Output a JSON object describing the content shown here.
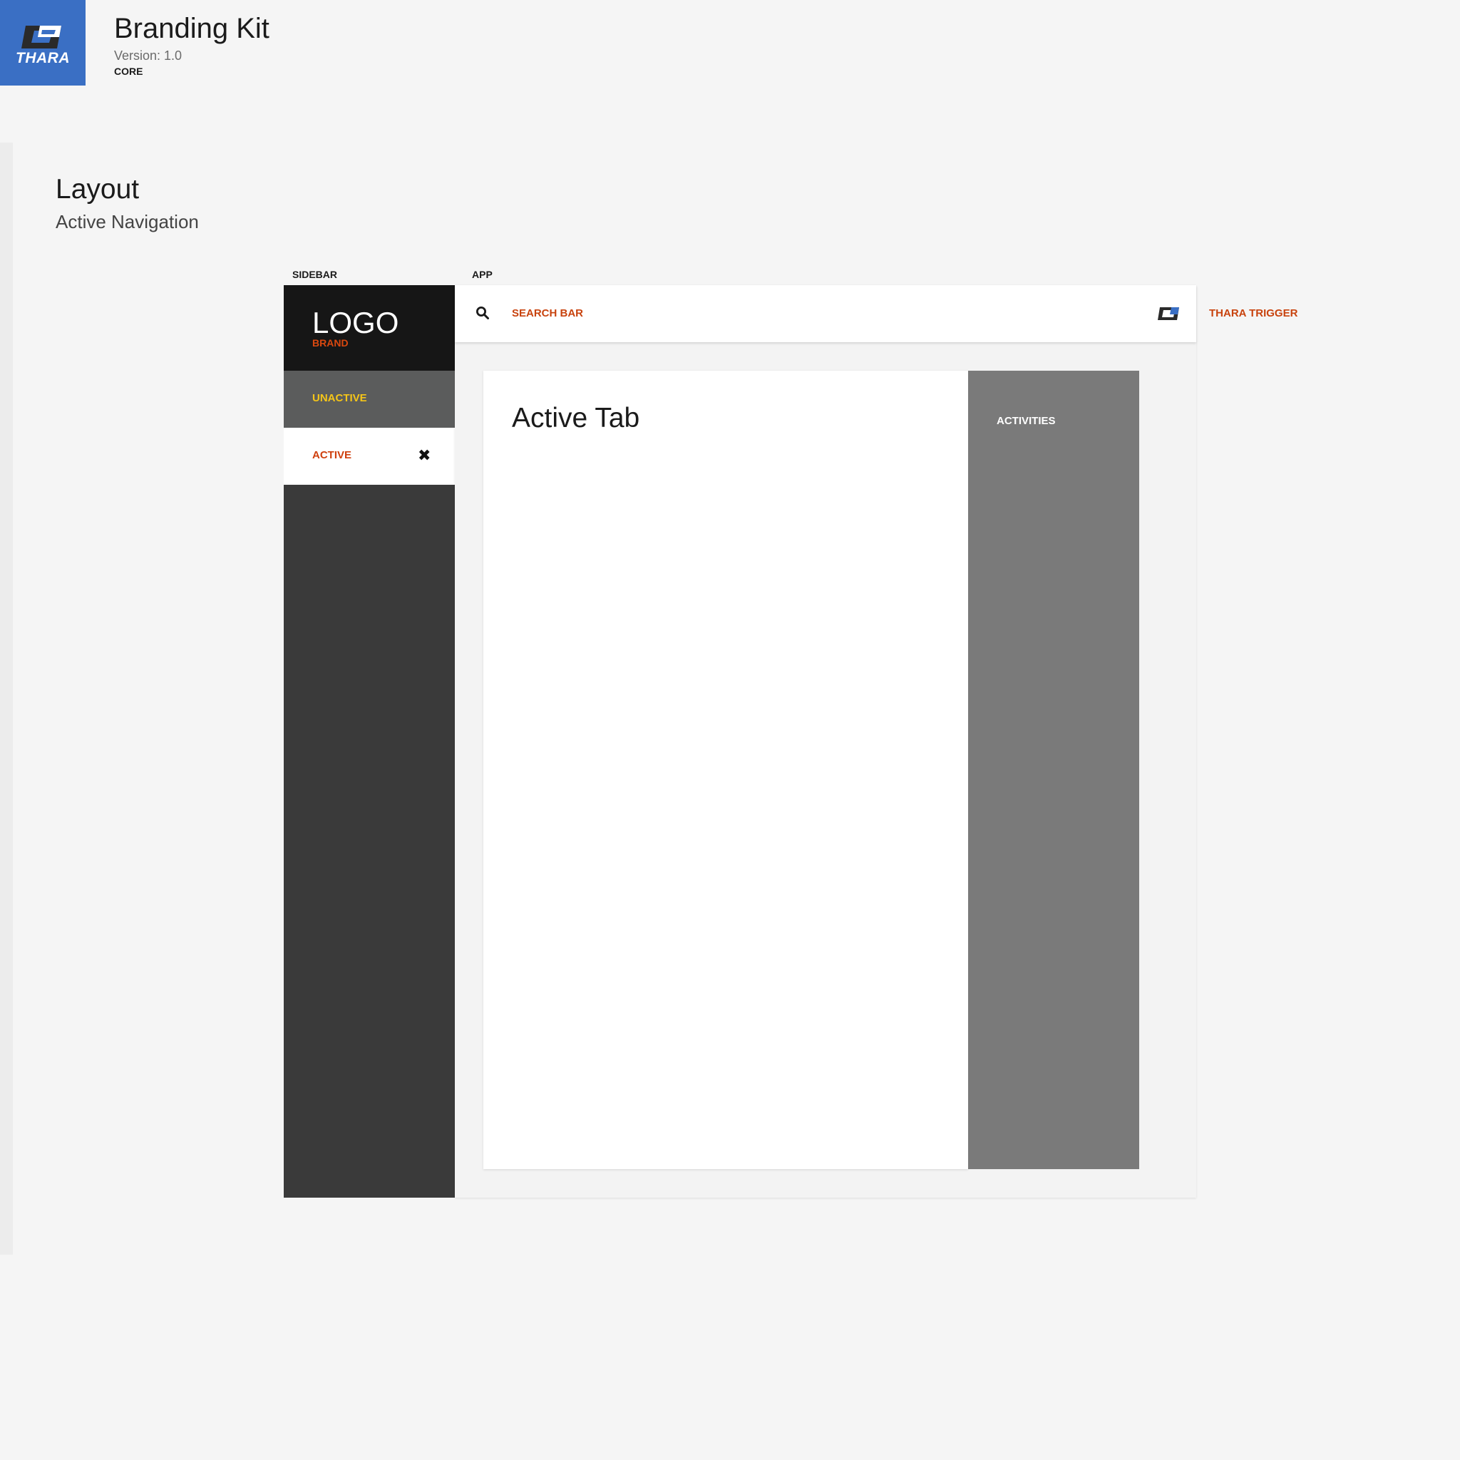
{
  "header": {
    "tile_word": "THARA",
    "title": "Branding Kit",
    "version": "Version: 1.0",
    "edition": "CORE"
  },
  "section": {
    "title": "Layout",
    "subtitle": "Active Navigation"
  },
  "labels": {
    "sidebar": "SIDEBAR",
    "app": "APP"
  },
  "sidebar": {
    "logo_text": "LOGO",
    "brand_text": "BRAND",
    "items": [
      {
        "label": "UNACTIVE",
        "state": "inactive"
      },
      {
        "label": "ACTIVE",
        "state": "active",
        "close_glyph": "✖"
      }
    ]
  },
  "app": {
    "search_label": "SEARCH BAR",
    "trigger_label": "THARA TRIGGER",
    "active_tab_title": "Active Tab",
    "activities_label": "ACTIVITIES"
  },
  "icons": {
    "brand_mark": "thara-logo-icon",
    "search": "search-icon",
    "trigger": "thara-trigger-icon",
    "close": "close-icon"
  },
  "colors": {
    "brand_blue": "#3a6fc4",
    "accent_orange": "#cf3f0d",
    "inactive_yellow": "#f5c518",
    "sidebar_dark": "#3a3a3a",
    "logo_block": "#161616",
    "inactive_item": "#5b5c5c",
    "activities_gray": "#7a7a7a"
  }
}
